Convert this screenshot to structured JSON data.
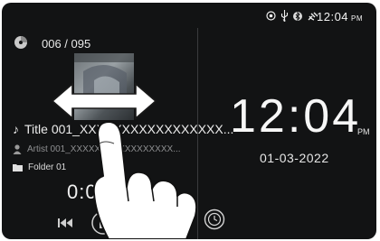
{
  "status": {
    "time": "12:04",
    "ampm": "PM",
    "icons": [
      "circle-target-icon",
      "usb-icon",
      "bluetooth-icon",
      "satellite-icon"
    ]
  },
  "media": {
    "track_count": "006 / 095",
    "title": "Title 001_XXXXXXXXXXXXXXXXX...",
    "artist": "Artist 001_XXXXXXXXXXXXXXXXX...",
    "folder": "Folder 01",
    "elapsed": "0:00"
  },
  "clock": {
    "time": "12:04",
    "ampm": "PM",
    "date": "01-03-2022"
  },
  "colors": {
    "background": "#121314",
    "text": "#f2f2f2",
    "muted": "#8e8f91"
  }
}
